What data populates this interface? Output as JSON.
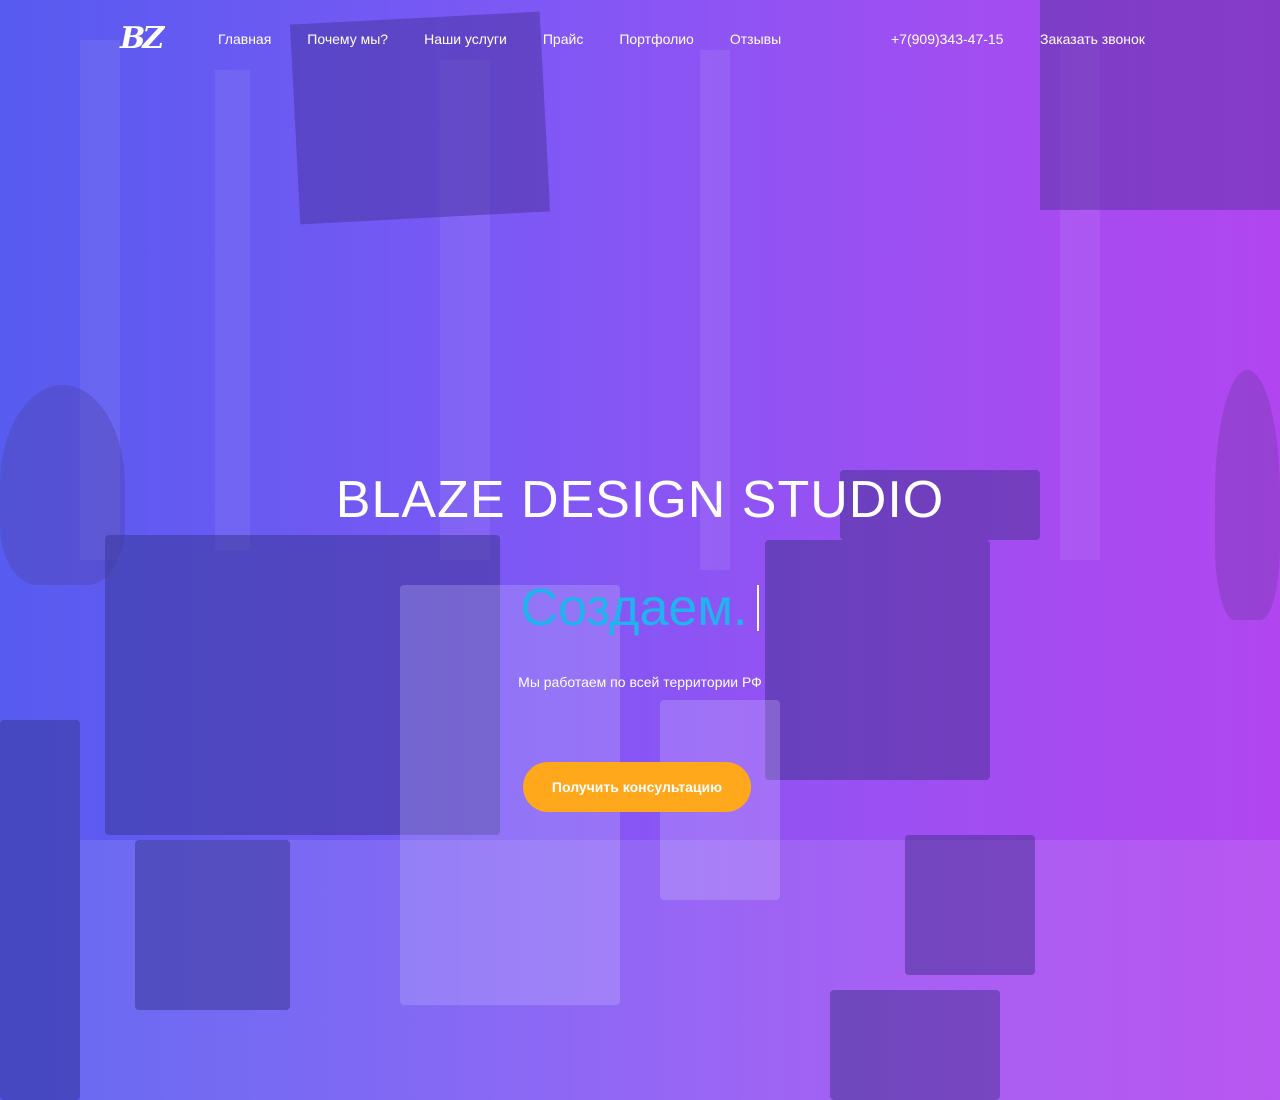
{
  "header": {
    "logo_text": "BZ",
    "nav": [
      {
        "label": "Главная"
      },
      {
        "label": "Почему мы?"
      },
      {
        "label": "Наши услуги"
      },
      {
        "label": "Прайс"
      },
      {
        "label": "Портфолио"
      },
      {
        "label": "Отзывы"
      }
    ],
    "phone": "+7(909)343-47-15",
    "callback_label": "Заказать звонок"
  },
  "hero": {
    "title": "BLAZE DESIGN STUDIO",
    "typed_text": "Создаем.",
    "subtitle": "Мы работаем по всей территории РФ",
    "cta_label": "Получить консультацию"
  },
  "colors": {
    "gradient_left": "#5b5cf0",
    "gradient_right": "#b246ef",
    "typed_text": "#1fb4ee",
    "cta_background": "#ffa81c",
    "text": "#ffffff"
  }
}
